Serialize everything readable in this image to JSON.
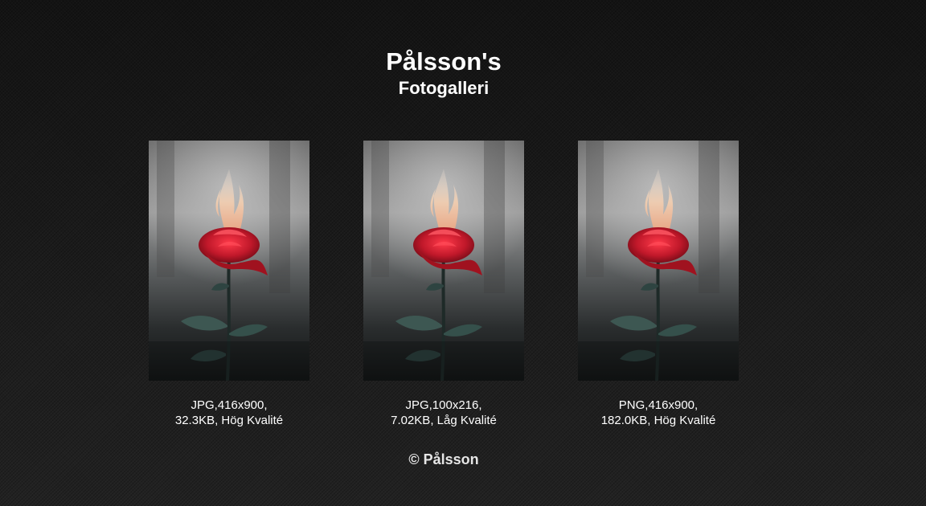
{
  "header": {
    "title": "Pålsson's",
    "subtitle": "Fotogalleri"
  },
  "gallery": {
    "items": [
      {
        "image_icon": "rose-on-fire-photo",
        "caption_line1": "JPG,416x900,",
        "caption_line2": "32.3KB, Hög Kvalité"
      },
      {
        "image_icon": "rose-on-fire-photo",
        "caption_line1": "JPG,100x216,",
        "caption_line2": "7.02KB, Låg Kvalité"
      },
      {
        "image_icon": "rose-on-fire-photo",
        "caption_line1": "PNG,416x900,",
        "caption_line2": "182.0KB, Hög Kvalité"
      }
    ]
  },
  "footer": {
    "copyright": "© Pålsson"
  },
  "colors": {
    "background": "#161616",
    "text": "#ffffff",
    "rose_red": "#c0182a",
    "leaf_teal": "#3d5752"
  }
}
